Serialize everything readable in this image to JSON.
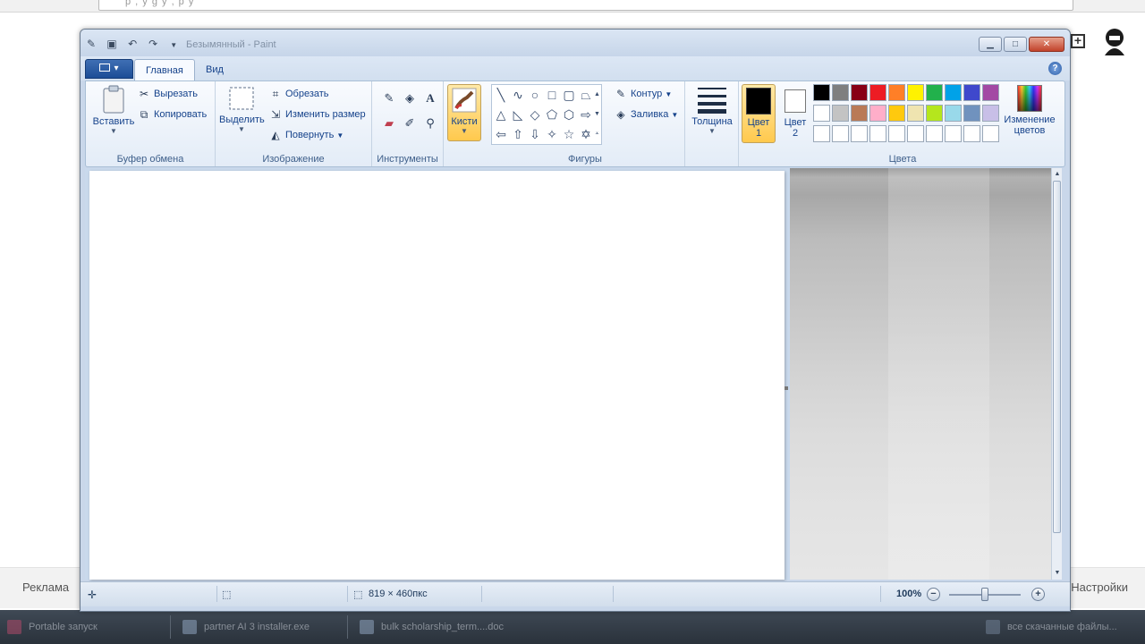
{
  "browser": {
    "address_hint": "p   ,  y  g  y  ,              p                                                      y",
    "footer_left": "Реклама",
    "footer_right": "Настройки"
  },
  "taskbar": {
    "items": [
      {
        "label": "Portable запуск"
      },
      {
        "label": "partner AI 3 installer.exe"
      },
      {
        "label": "bulk scholarship_term....doc"
      }
    ],
    "tray_text": "все скачанные файлы..."
  },
  "window": {
    "title": "Безымянный - Paint"
  },
  "tabs": {
    "home": "Главная",
    "view": "Вид"
  },
  "ribbon": {
    "clipboard": {
      "label": "Буфер обмена",
      "paste": "Вставить",
      "cut": "Вырезать",
      "copy": "Копировать"
    },
    "image": {
      "label": "Изображение",
      "select": "Выделить",
      "crop": "Обрезать",
      "resize": "Изменить размер",
      "rotate": "Повернуть"
    },
    "tools": {
      "label": "Инструменты"
    },
    "brushes": {
      "label": "Кисти"
    },
    "shapes": {
      "label": "Фигуры",
      "outline": "Контур",
      "fill": "Заливка"
    },
    "size": {
      "label": "Толщина"
    },
    "colors": {
      "label": "Цвета",
      "color1": "Цвет",
      "color1_num": "1",
      "color2": "Цвет",
      "color2_num": "2",
      "edit_line1": "Изменение",
      "edit_line2": "цветов",
      "color1_value": "#000000",
      "color2_value": "#ffffff",
      "palette_row1": [
        "#000000",
        "#7f7f7f",
        "#880015",
        "#ed1c24",
        "#ff7f27",
        "#fff200",
        "#22b14c",
        "#00a2e8",
        "#3f48cc",
        "#a349a4"
      ],
      "palette_row2": [
        "#ffffff",
        "#c3c3c3",
        "#b97a57",
        "#ffaec9",
        "#ffc90e",
        "#efe4b0",
        "#b5e61d",
        "#99d9ea",
        "#7092be",
        "#c8bfe7"
      ],
      "palette_row3": [
        "#ffffff",
        "#ffffff",
        "#ffffff",
        "#ffffff",
        "#ffffff",
        "#ffffff",
        "#ffffff",
        "#ffffff",
        "#ffffff",
        "#ffffff"
      ]
    }
  },
  "statusbar": {
    "dimensions": "819 × 460пкс",
    "zoom": "100%"
  }
}
